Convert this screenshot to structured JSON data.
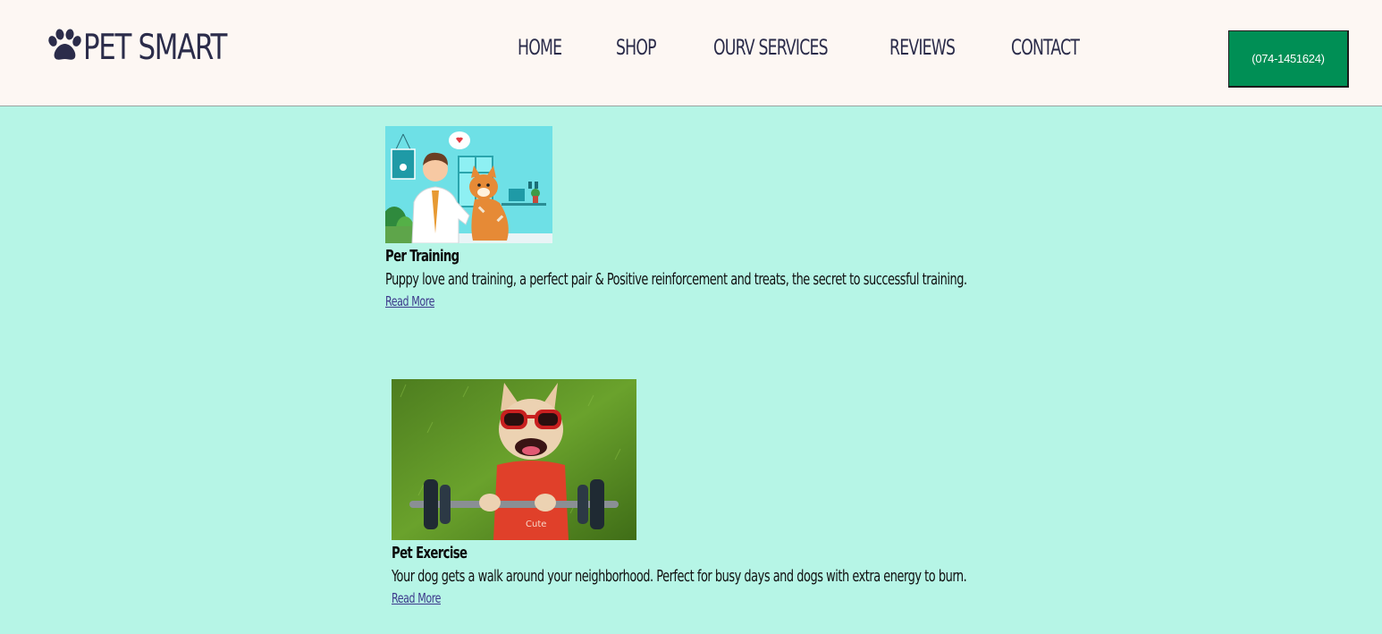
{
  "header": {
    "logo_text": "PET SMART",
    "logo_icon": "paw-icon",
    "nav": [
      "HOME",
      "SHOP",
      "OURV SERVICES",
      "REVIEWS",
      "CONTACT"
    ],
    "phone_label": "(074-1451624)"
  },
  "cards": [
    {
      "title": "Per Training",
      "description": "Puppy love and training, a perfect pair & Positive reinforcement and treats, the secret to successful training.",
      "link": "Read More",
      "image": "vet-with-dog-illustration"
    },
    {
      "title": "Pet Exercise",
      "description": "Your dog gets a walk around your neighborhood. Perfect for busy days and dogs with extra energy to burn.",
      "link": "Read More",
      "image": "dog-with-sunglasses-and-barbell"
    }
  ],
  "colors": {
    "page_bg": "#b6f5e6",
    "header_bg": "#fdf7f3",
    "brand_text": "#2b2c4a",
    "button_bg": "#008f55",
    "link": "#3d3a8c"
  }
}
